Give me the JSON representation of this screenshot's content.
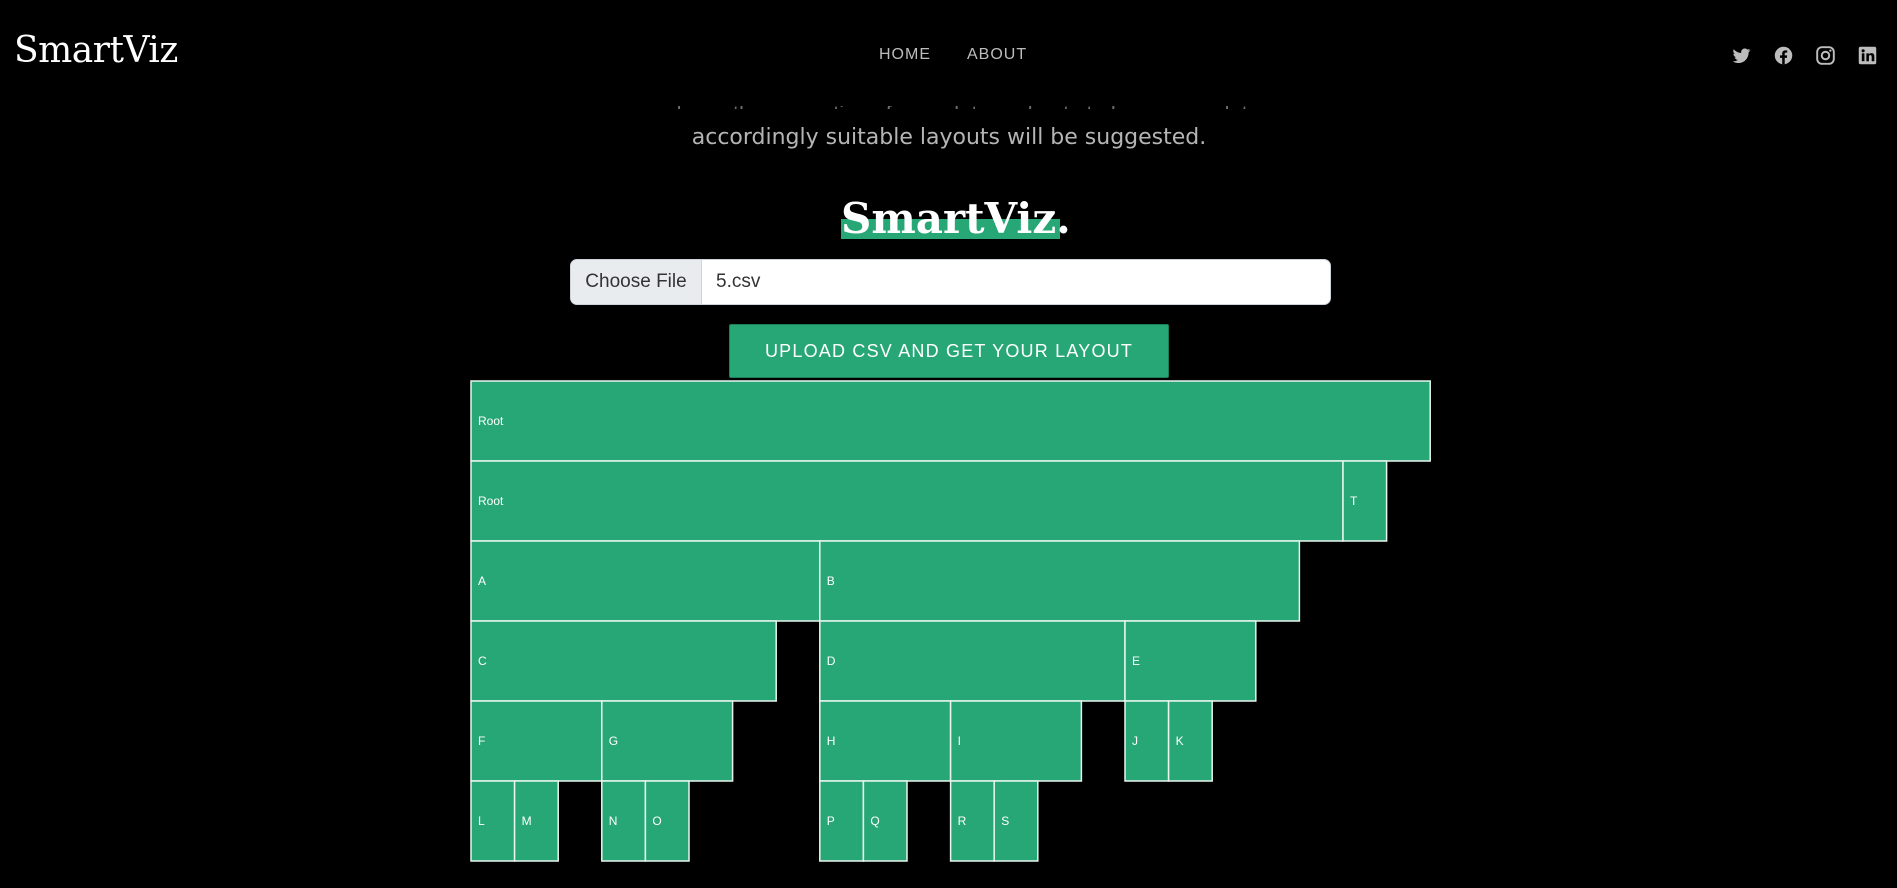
{
  "header": {
    "brand": "SmartViz",
    "nav": [
      {
        "label": "HOME"
      },
      {
        "label": "ABOUT"
      }
    ],
    "social_icons": [
      "twitter-icon",
      "facebook-icon",
      "instagram-icon",
      "linkedin-icon"
    ]
  },
  "intro": {
    "line_partial": "analyzes the properties of your data and gets to know your data",
    "line": "accordingly suitable layouts will be suggested."
  },
  "hero": {
    "title": "SmartViz."
  },
  "upload": {
    "choose_label": "Choose File",
    "file_name": "5.csv",
    "button_label": "UPLOAD CSV AND GET YOUR LAYOUT"
  },
  "colors": {
    "accent": "#28a776",
    "background": "#000000",
    "node_border": "#e8f5ef"
  },
  "chart_data": {
    "type": "icicle",
    "tree": {
      "name": "Root",
      "value": 22,
      "children": [
        {
          "name": "Root",
          "value": 20,
          "children": [
            {
              "name": "A",
              "value": 8,
              "children": [
                {
                  "name": "C",
                  "value": 7,
                  "children": [
                    {
                      "name": "F",
                      "value": 3,
                      "children": [
                        {
                          "name": "L",
                          "value": 1
                        },
                        {
                          "name": "M",
                          "value": 1
                        }
                      ]
                    },
                    {
                      "name": "G",
                      "value": 3,
                      "children": [
                        {
                          "name": "N",
                          "value": 1
                        },
                        {
                          "name": "O",
                          "value": 1
                        }
                      ]
                    }
                  ]
                }
              ]
            },
            {
              "name": "B",
              "value": 11,
              "children": [
                {
                  "name": "D",
                  "value": 7,
                  "children": [
                    {
                      "name": "H",
                      "value": 3,
                      "children": [
                        {
                          "name": "P",
                          "value": 1
                        },
                        {
                          "name": "Q",
                          "value": 1
                        }
                      ]
                    },
                    {
                      "name": "I",
                      "value": 3,
                      "children": [
                        {
                          "name": "R",
                          "value": 1
                        },
                        {
                          "name": "S",
                          "value": 1
                        }
                      ]
                    }
                  ]
                },
                {
                  "name": "E",
                  "value": 3,
                  "children": [
                    {
                      "name": "J",
                      "value": 1
                    },
                    {
                      "name": "K",
                      "value": 1
                    }
                  ]
                }
              ]
            }
          ]
        },
        {
          "name": "T",
          "value": 1
        }
      ]
    }
  }
}
